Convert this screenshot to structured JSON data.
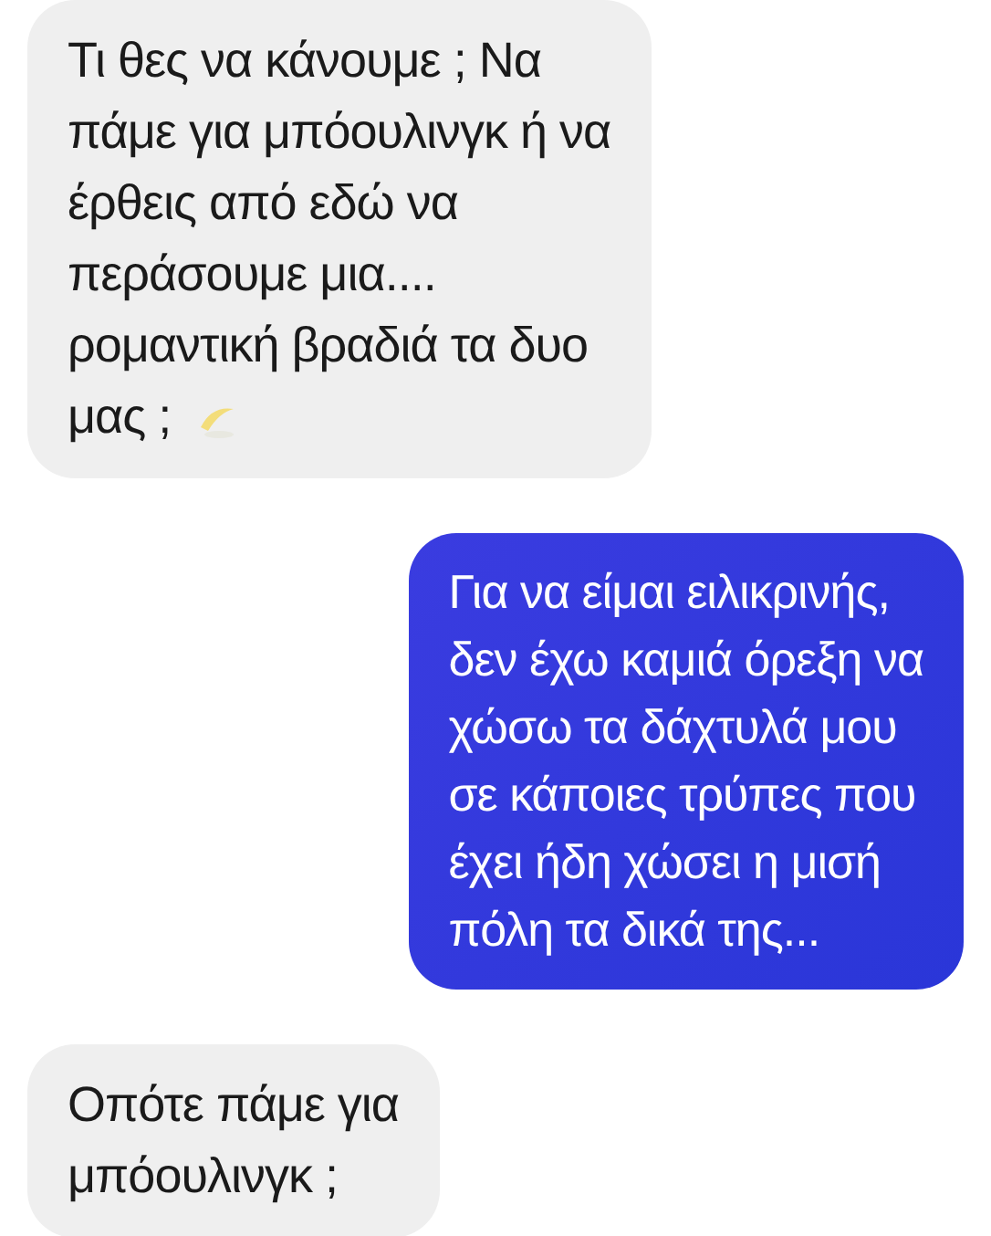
{
  "messages": [
    {
      "kind": "received",
      "text": "Τι θες να κάνουμε ; Να\nπάμε για μπόουλινγκ ή να\nέρθεις από εδώ να\nπεράσουμε μια....\nρομαντική βραδιά τα δυο\nμας ;",
      "emoji": true
    },
    {
      "kind": "sent",
      "text": "Για να είμαι ειλικρινής,\nδεν έχω καμιά όρεξη να\nχώσω τα δάχτυλά μου\nσε κάποιες τρύπες που\nέχει ήδη χώσει η μισή\nπόλη τα δικά της...",
      "emoji": false
    },
    {
      "kind": "received",
      "text": "Οπότε πάμε για\nμπόουλινγκ ;",
      "emoji": false
    }
  ]
}
